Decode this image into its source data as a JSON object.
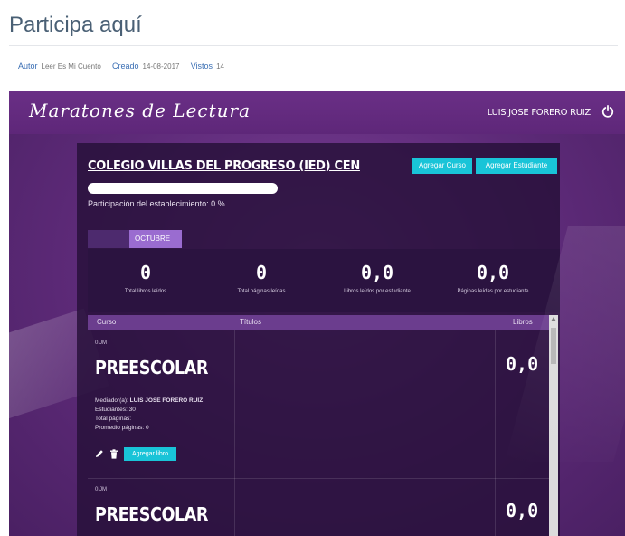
{
  "page": {
    "title": "Participa aquí",
    "meta": [
      {
        "key": "Autor",
        "value": "Leer Es Mi Cuento"
      },
      {
        "key": "Creado",
        "value": "14-08-2017"
      },
      {
        "key": "Vistos",
        "value": "14"
      }
    ]
  },
  "app": {
    "logo_text": "Maratones de Lectura",
    "user_name": "LUIS JOSE FORERO RUIZ",
    "power_icon": "power-icon"
  },
  "school": {
    "name": "COLEGIO VILLAS DEL PROGRESO (IED) CEN",
    "add_course_label": "Agregar Curso",
    "add_student_label": "Agregar Estudiante",
    "participation_text": "Participación del establecimiento: 0 %",
    "participation_percent": 0
  },
  "tabs": [
    {
      "label": ""
    },
    {
      "label": "OCTUBRE"
    }
  ],
  "stats": [
    {
      "value": "0",
      "label": "Total libros leídos"
    },
    {
      "value": "0",
      "label": "Total páginas leídas"
    },
    {
      "value": "0,0",
      "label": "Libros leídos por estudiante"
    },
    {
      "value": "0,0",
      "label": "Páginas leídas por estudiante"
    }
  ],
  "table": {
    "headers": {
      "curso": "Curso",
      "titulos": "Títulos",
      "libros": "Libros"
    },
    "rows": [
      {
        "code": "0IJM",
        "grade": "PREESCOLAR",
        "libros": "0,0",
        "mediator_label": "Mediador(a):",
        "mediator": "LUIS JOSE FORERO RUIZ",
        "students": "Estudiantes: 30",
        "total_pages": "Total páginas:",
        "avg_pages": "Promedio páginas: 0",
        "add_book_label": "Agregar libro"
      },
      {
        "code": "0IJM",
        "grade": "PREESCOLAR",
        "libros": "0,0"
      }
    ]
  },
  "colors": {
    "accent": "#19c4d8",
    "purple_bg": "#5d2a78",
    "tab_active": "#9a6cd0"
  }
}
